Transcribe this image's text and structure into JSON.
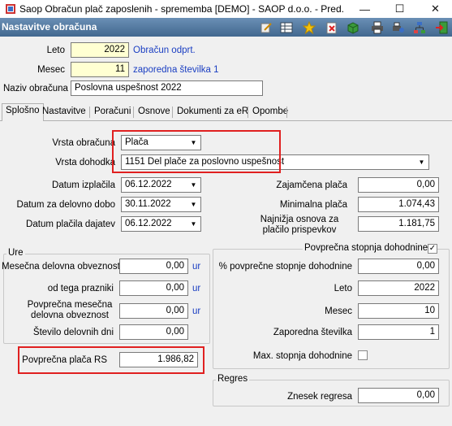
{
  "window": {
    "title": "Saop Obračun plač zaposlenih - sprememba [DEMO] - SAOP d.o.o. - Pred...",
    "minimize": "—",
    "maximize": "☐",
    "close": "✕"
  },
  "header": {
    "title": "Nastavitve obračuna"
  },
  "toolbar": [
    "edit-icon",
    "table-icon",
    "star-icon",
    "delete-icon",
    "cube-icon",
    "print-icon",
    "print-settings-icon",
    "hierarchy-icon",
    "exit-icon"
  ],
  "top": {
    "leto_label": "Leto",
    "leto_value": "2022",
    "leto_desc": "Obračun odprt.",
    "mesec_label": "Mesec",
    "mesec_value": "11",
    "mesec_desc": "zaporedna številka 1",
    "naziv_label": "Naziv obračuna",
    "naziv_value": "Poslovna uspešnost 2022"
  },
  "tabs": [
    "Splošno",
    "Nastavitve",
    "Poračuni",
    "Osnove",
    "Dokumenti za eR",
    "Opombe"
  ],
  "general": {
    "vrsta_obracuna_label": "Vrsta obračuna",
    "vrsta_obracuna_value": "Plača",
    "vrsta_dohodka_label": "Vrsta dohodka",
    "vrsta_dohodka_value": "1151  Del plače za poslovno uspešnost",
    "datum_izplacila_label": "Datum izplačila",
    "datum_izplacila_value": "06.12.2022",
    "datum_delovno_label": "Datum za delovno dobo",
    "datum_delovno_value": "30.11.2022",
    "datum_dajatev_label": "Datum plačila dajatev",
    "datum_dajatev_value": "06.12.2022",
    "zajamcena_label": "Zajamčena plača",
    "zajamcena_value": "0,00",
    "minimalna_label": "Minimalna plača",
    "minimalna_value": "1.074,43",
    "najnizja_label1": "Najnižja osnova za",
    "najnizja_label2": "plačilo prispevkov",
    "najnizja_value": "1.181,75"
  },
  "ure": {
    "title": "Ure",
    "mesecna_label": "Mesečna delovna obveznost",
    "mesecna_value": "0,00",
    "mesecna_unit": "ur",
    "prazniki_label": "od tega prazniki",
    "prazniki_value": "0,00",
    "prazniki_unit": "ur",
    "povp_label1": "Povprečna mesečna",
    "povp_label2": "delovna obveznost",
    "povp_value": "0,00",
    "povp_unit": "ur",
    "dni_label": "Število delovnih dni",
    "dni_value": "0,00"
  },
  "povp_placa": {
    "label": "Povprečna plača RS",
    "value": "1.986,82"
  },
  "dohodnina": {
    "title": "Povprečna stopnja dohodnine",
    "checked": "✓",
    "pct_label": "% povprečne stopnje dohodnine",
    "pct_value": "0,00",
    "leto_label": "Leto",
    "leto_value": "2022",
    "mesec_label": "Mesec",
    "mesec_value": "10",
    "zap_label": "Zaporedna številka",
    "zap_value": "1",
    "max_label": "Max. stopnja dohodnine"
  },
  "regres": {
    "title": "Regres",
    "znesek_label": "Znesek regresa",
    "znesek_value": "0,00"
  }
}
